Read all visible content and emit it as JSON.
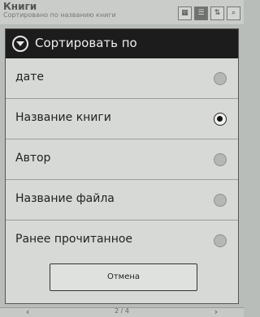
{
  "background": {
    "title": "Книги",
    "subtitle": "Сортировано по названию книги",
    "page_indicator": "2 / 4",
    "prev_icon": "chevron-left-icon",
    "next_icon": "chevron-right-icon"
  },
  "dialog": {
    "title": "Сортировать по",
    "options": [
      {
        "label": "дате",
        "selected": false
      },
      {
        "label": "Название книги",
        "selected": true
      },
      {
        "label": "Автор",
        "selected": false
      },
      {
        "label": "Название файла",
        "selected": false
      },
      {
        "label": "Ранее прочитанное",
        "selected": false
      }
    ],
    "cancel_label": "Отмена"
  }
}
